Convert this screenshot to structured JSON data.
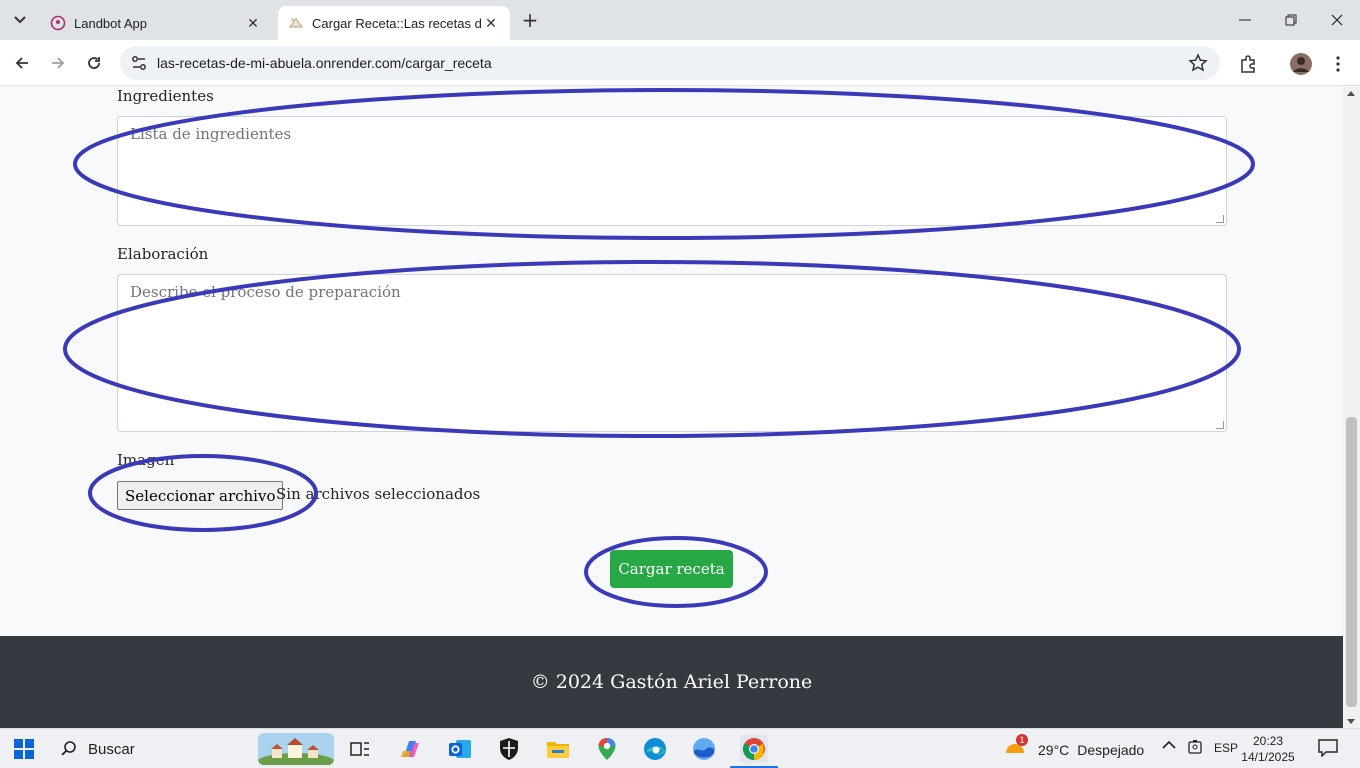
{
  "browser": {
    "tabs": [
      {
        "title": "Landbot App",
        "close": "✕"
      },
      {
        "title": "Cargar Receta::Las recetas de mi abuela",
        "close": "✕"
      }
    ],
    "new_tab": "+",
    "url": "las-recetas-de-mi-abuela.onrender.com/cargar_receta",
    "window_controls": {
      "minimize": "—",
      "maximize": "❐",
      "close": "✕"
    },
    "icons": [
      "tab-search-icon",
      "back-arrow-icon",
      "forward-arrow-icon",
      "reload-icon",
      "site-info-icon",
      "bookmark-star-icon",
      "extensions-icon",
      "profile-avatar-icon",
      "menu-kebab-icon"
    ]
  },
  "form": {
    "ingredients": {
      "label": "Ingredientes",
      "placeholder": "Lista de ingredientes"
    },
    "preparation": {
      "label": "Elaboración",
      "placeholder": "Describe el proceso de preparación"
    },
    "image": {
      "label": "Imagen",
      "button": "Seleccionar archivo",
      "status": "Sin archivos seleccionados"
    },
    "submit": "Cargar receta"
  },
  "footer": {
    "text": "© 2024 Gastón Ariel Perrone"
  },
  "colors": {
    "submit_bg": "#28a745",
    "footer_bg": "#343a40",
    "annotation": "#3a3ab8"
  },
  "taskbar": {
    "search_placeholder": "Buscar",
    "weather_temp": "29°C",
    "weather_desc": "Despejado",
    "weather_badge": "1",
    "language": "ESP",
    "time": "20:23",
    "date": "14/1/2025",
    "pinned": [
      "task-view-icon",
      "copilot-icon",
      "outlook-icon",
      "security-icon",
      "file-explorer-icon",
      "maps-icon",
      "edge-icon",
      "photos-icon",
      "chrome-icon"
    ]
  }
}
